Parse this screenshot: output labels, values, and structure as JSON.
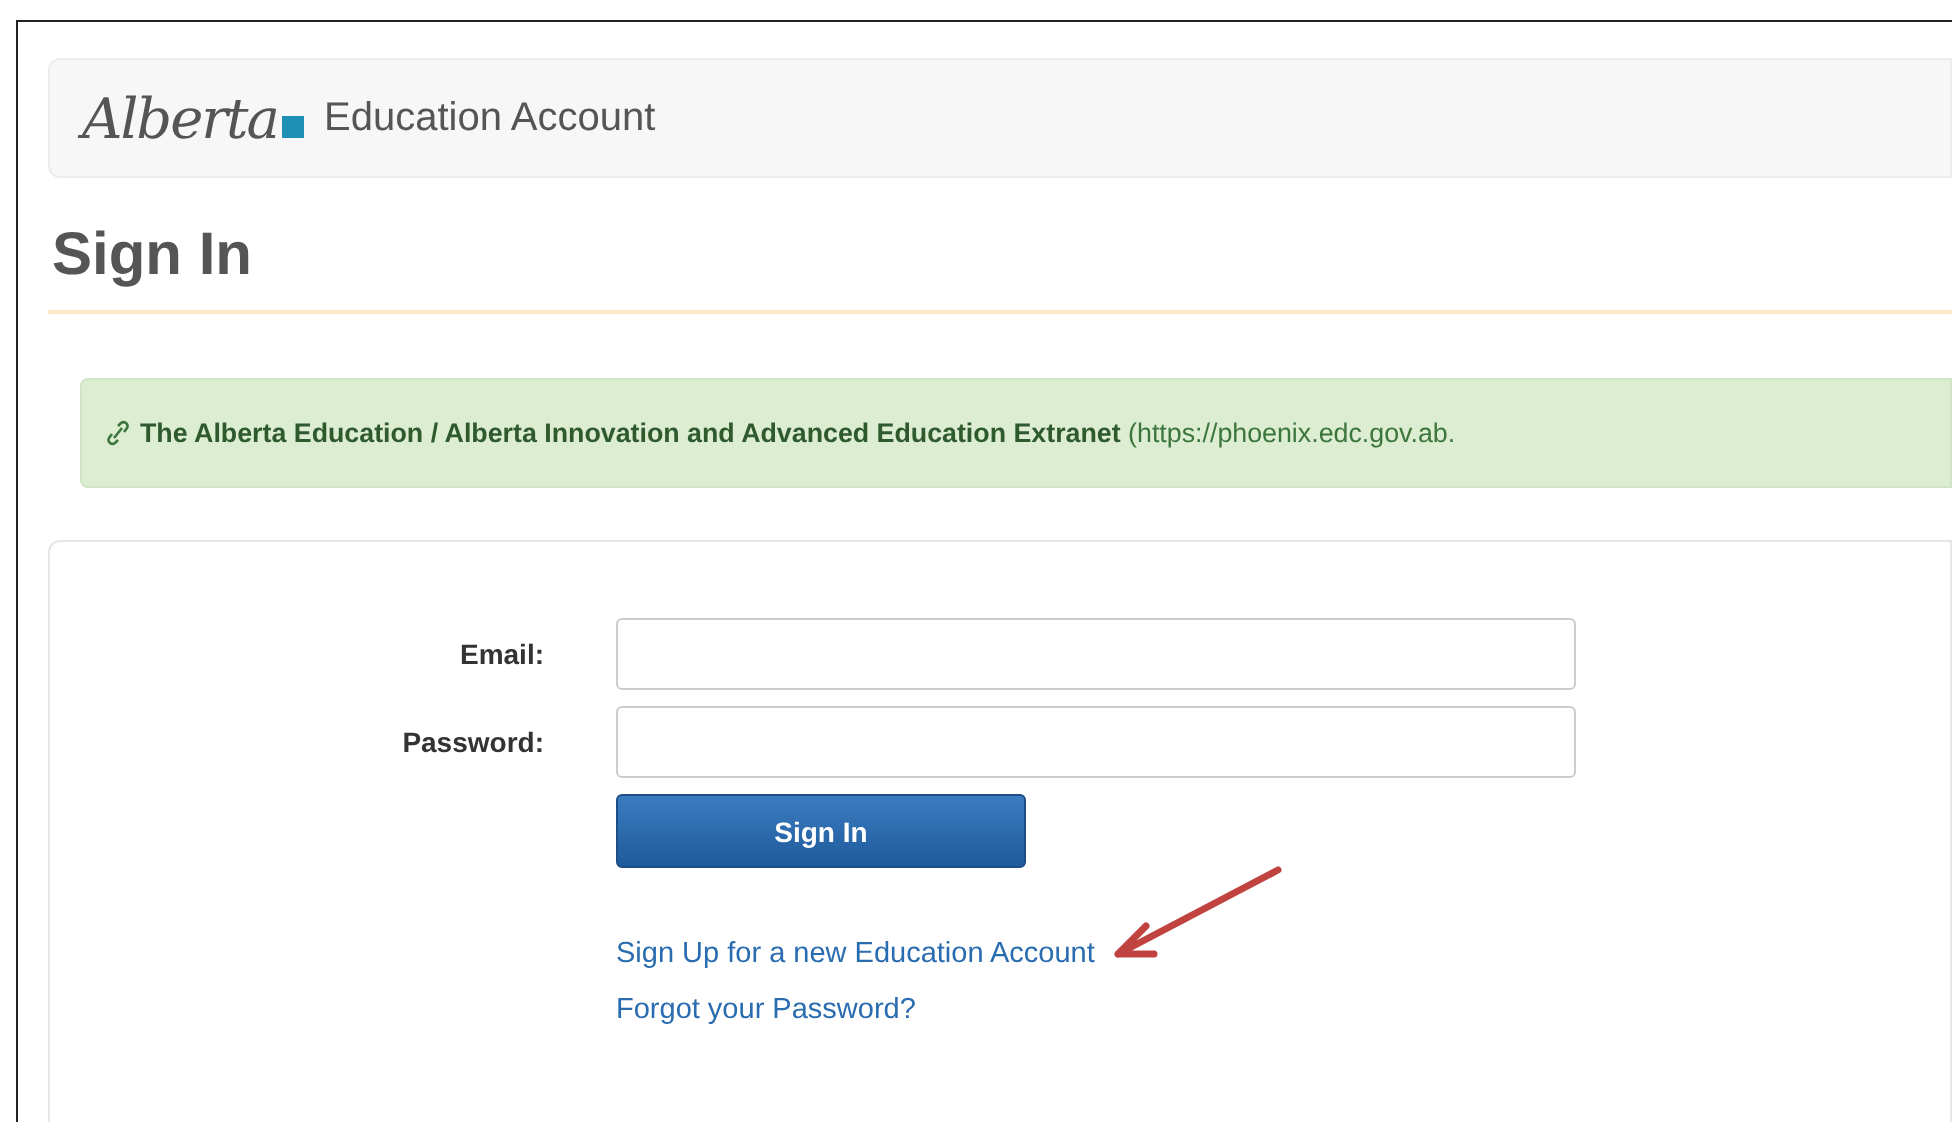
{
  "header": {
    "logo": "Alberta",
    "title": "Education Account"
  },
  "heading": "Sign In",
  "banner": {
    "text": "**The Alberta Education / Alberta Innovation and Advanced Education Extranet** (https://phoenix.edc.gov.ab."
  },
  "form": {
    "fields": [
      {
        "label": "Email:"
      },
      {
        "label": "Password:"
      }
    ],
    "submit": "Sign In",
    "links": [
      {
        "text": "Sign Up for a new Education Account",
        "callout": true
      },
      {
        "text": "Forgot your Password?",
        "callout": false
      }
    ]
  }
}
